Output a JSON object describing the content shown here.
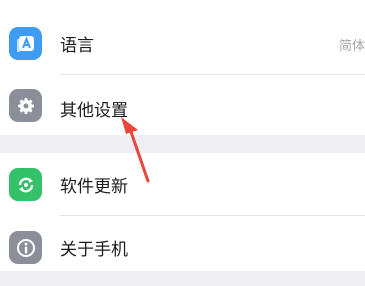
{
  "settings": {
    "rows": [
      {
        "label": "语言",
        "value": "简体",
        "icon": "language-icon",
        "color": "#3e9df2"
      },
      {
        "label": "其他设置",
        "icon": "gear-icon",
        "color": "#8c8f9a"
      },
      {
        "label": "软件更新",
        "icon": "update-icon",
        "color": "#35c06a"
      },
      {
        "label": "关于手机",
        "icon": "info-icon",
        "color": "#8c8f9a"
      }
    ]
  },
  "annotation": {
    "color": "#e8453c"
  }
}
